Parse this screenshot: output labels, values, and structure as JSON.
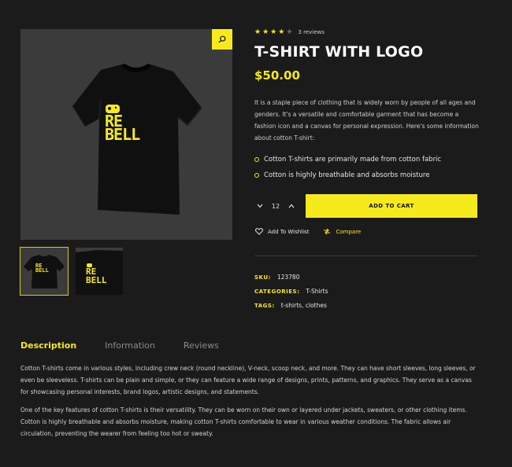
{
  "rating": {
    "stars": 4,
    "max": 5,
    "reviews": "3 reviews"
  },
  "product": {
    "title": "T-SHIRT WITH LOGO",
    "price": "$50.00",
    "intro": "It is a staple piece of clothing that is widely worn by people of all ages and genders. It's a versatile and comfortable garment that has become a fashion icon and a canvas for personal expression. Here's some information about cotton T-shirt:",
    "bullets": [
      "Cotton T-shirts are primarily made from cotton fabric",
      "Cotton is highly breathable and absorbs moisture"
    ],
    "logo_text": "REBELL"
  },
  "cart": {
    "quantity": "12",
    "add_label": "ADD TO CART"
  },
  "actions": {
    "wishlist": "Add To Wishlist",
    "compare": "Compare"
  },
  "meta": {
    "sku_label": "SKU:",
    "sku": "123780",
    "categories_label": "CATEGORIES:",
    "categories": "T-Shirts",
    "tags_label": "TAGS:",
    "tags": "t-shirts, clothes"
  },
  "tabs": [
    "Description",
    "Information",
    "Reviews"
  ],
  "description": [
    "Cotton T-shirts come in various styles, including crew neck (round neckline), V-neck, scoop neck, and more. They can have short sleeves, long sleeves, or even be sleeveless. T-shirts can be plain and simple, or they can feature a wide range of designs, prints, patterns, and graphics. They serve as a canvas for showcasing personal interests, brand logos, artistic designs, and statements.",
    "One of the key features of cotton T-shirts is their versatility. They can be worn on their own or layered under jackets, sweaters, or other clothing items. Cotton is highly breathable and absorbs moisture, making cotton T-shirts comfortable to wear in various weather conditions. The fabric allows air circulation, preventing the wearer from feeling too hot or sweaty."
  ],
  "colors": {
    "accent": "#f6ea1c",
    "background": "#1b1b1b",
    "image_bg": "#3b3b3b"
  },
  "icons": [
    "search-icon",
    "star-icon",
    "chevron-down-icon",
    "chevron-up-icon",
    "heart-icon",
    "compare-icon"
  ]
}
